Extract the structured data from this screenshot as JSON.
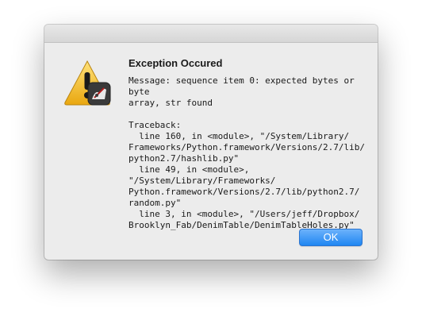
{
  "dialog": {
    "title": "Exception Occured",
    "message": "Message: sequence item 0: expected bytes or byte\narray, str found\n\nTraceback:\n  line 160, in <module>, \"/System/Library/\nFrameworks/Python.framework/Versions/2.7/lib/\npython2.7/hashlib.py\"\n  line 49, in <module>, \"/System/Library/Frameworks/\nPython.framework/Versions/2.7/lib/python2.7/\nrandom.py\"\n  line 3, in <module>, \"/Users/jeff/Dropbox/\nBrooklyn_Fab/DenimTable/DenimTableHoles.py\"",
    "ok_label": "OK",
    "icon": "warning-triangle-icon",
    "badge_icon": "app-badge-icon"
  },
  "colors": {
    "dialog_bg": "#ececec",
    "warning_yellow": "#f4c430",
    "button_blue": "#1f86f2"
  }
}
